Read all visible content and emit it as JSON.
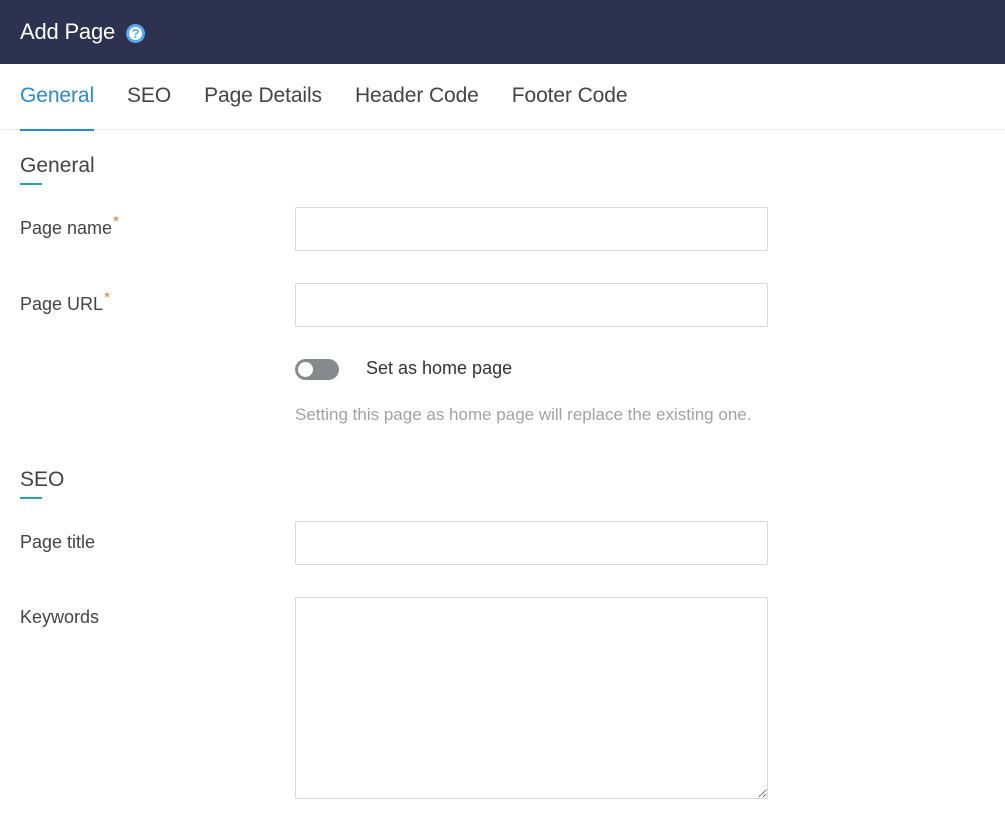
{
  "header": {
    "title": "Add Page",
    "help_icon": "question-circle-icon"
  },
  "tabs": [
    {
      "label": "General",
      "active": true
    },
    {
      "label": "SEO",
      "active": false
    },
    {
      "label": "Page Details",
      "active": false
    },
    {
      "label": "Header Code",
      "active": false
    },
    {
      "label": "Footer Code",
      "active": false
    }
  ],
  "general": {
    "title": "General",
    "page_name": {
      "label": "Page name",
      "required_mark": "*",
      "value": ""
    },
    "page_url": {
      "label": "Page URL",
      "required_mark": "*",
      "value": ""
    },
    "home_toggle": {
      "label": "Set as home page",
      "checked": false
    },
    "hint": "Setting this page as home page will replace the existing one."
  },
  "seo": {
    "title": "SEO",
    "page_title": {
      "label": "Page title",
      "value": ""
    },
    "keywords": {
      "label": "Keywords",
      "value": ""
    }
  },
  "colors": {
    "header_bg": "#2c3250",
    "accent": "#2a8ad8",
    "section_underline": "#2aa8a0",
    "required": "#e0783a"
  }
}
